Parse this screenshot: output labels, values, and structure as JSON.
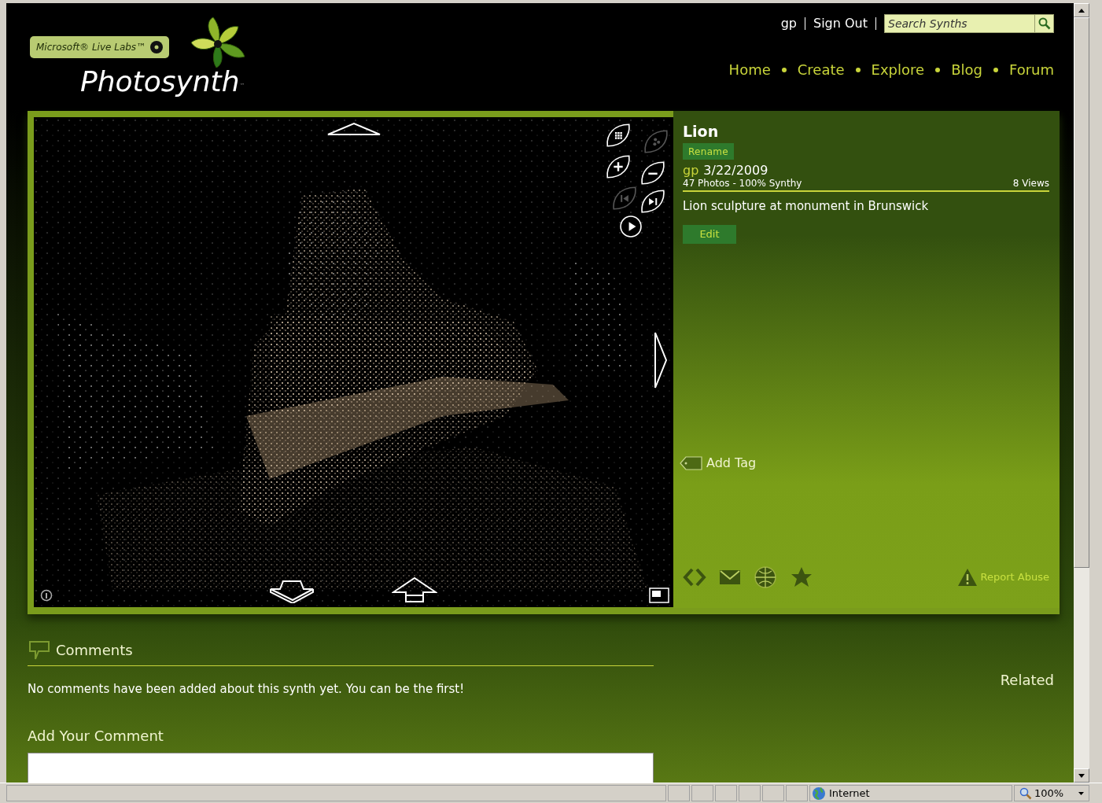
{
  "header": {
    "badge": "Microsoft® Live Labs™",
    "logo": "Photosynth",
    "trademark": "™",
    "user": "gp",
    "sign_out": "Sign Out",
    "search": {
      "placeholder": "Search Synths"
    },
    "nav": [
      "Home",
      "Create",
      "Explore",
      "Blog",
      "Forum"
    ]
  },
  "viewer": {
    "controls": [
      {
        "kind": "grid",
        "disabled": false
      },
      {
        "kind": "dots",
        "disabled": true
      },
      {
        "kind": "zoom_in",
        "disabled": false
      },
      {
        "kind": "zoom_out",
        "disabled": false
      },
      {
        "kind": "previous",
        "disabled": true
      },
      {
        "kind": "next",
        "disabled": false
      },
      {
        "kind": "play",
        "disabled": false
      }
    ]
  },
  "synth": {
    "title": "Lion",
    "rename": "Rename",
    "author": "gp",
    "date": "3/22/2009",
    "stats": "47 Photos - 100% Synthy",
    "views": "8 Views",
    "description": "Lion sculpture at monument in Brunswick",
    "edit": "Edit",
    "add_tag": "Add Tag",
    "report": "Report Abuse"
  },
  "comments": {
    "heading": "Comments",
    "empty": "No comments have been added about this synth yet. You can be the first!",
    "add_heading": "Add Your Comment"
  },
  "related": {
    "heading": "Related"
  },
  "status_bar": {
    "zone": "Internet",
    "zoom": "100%"
  }
}
